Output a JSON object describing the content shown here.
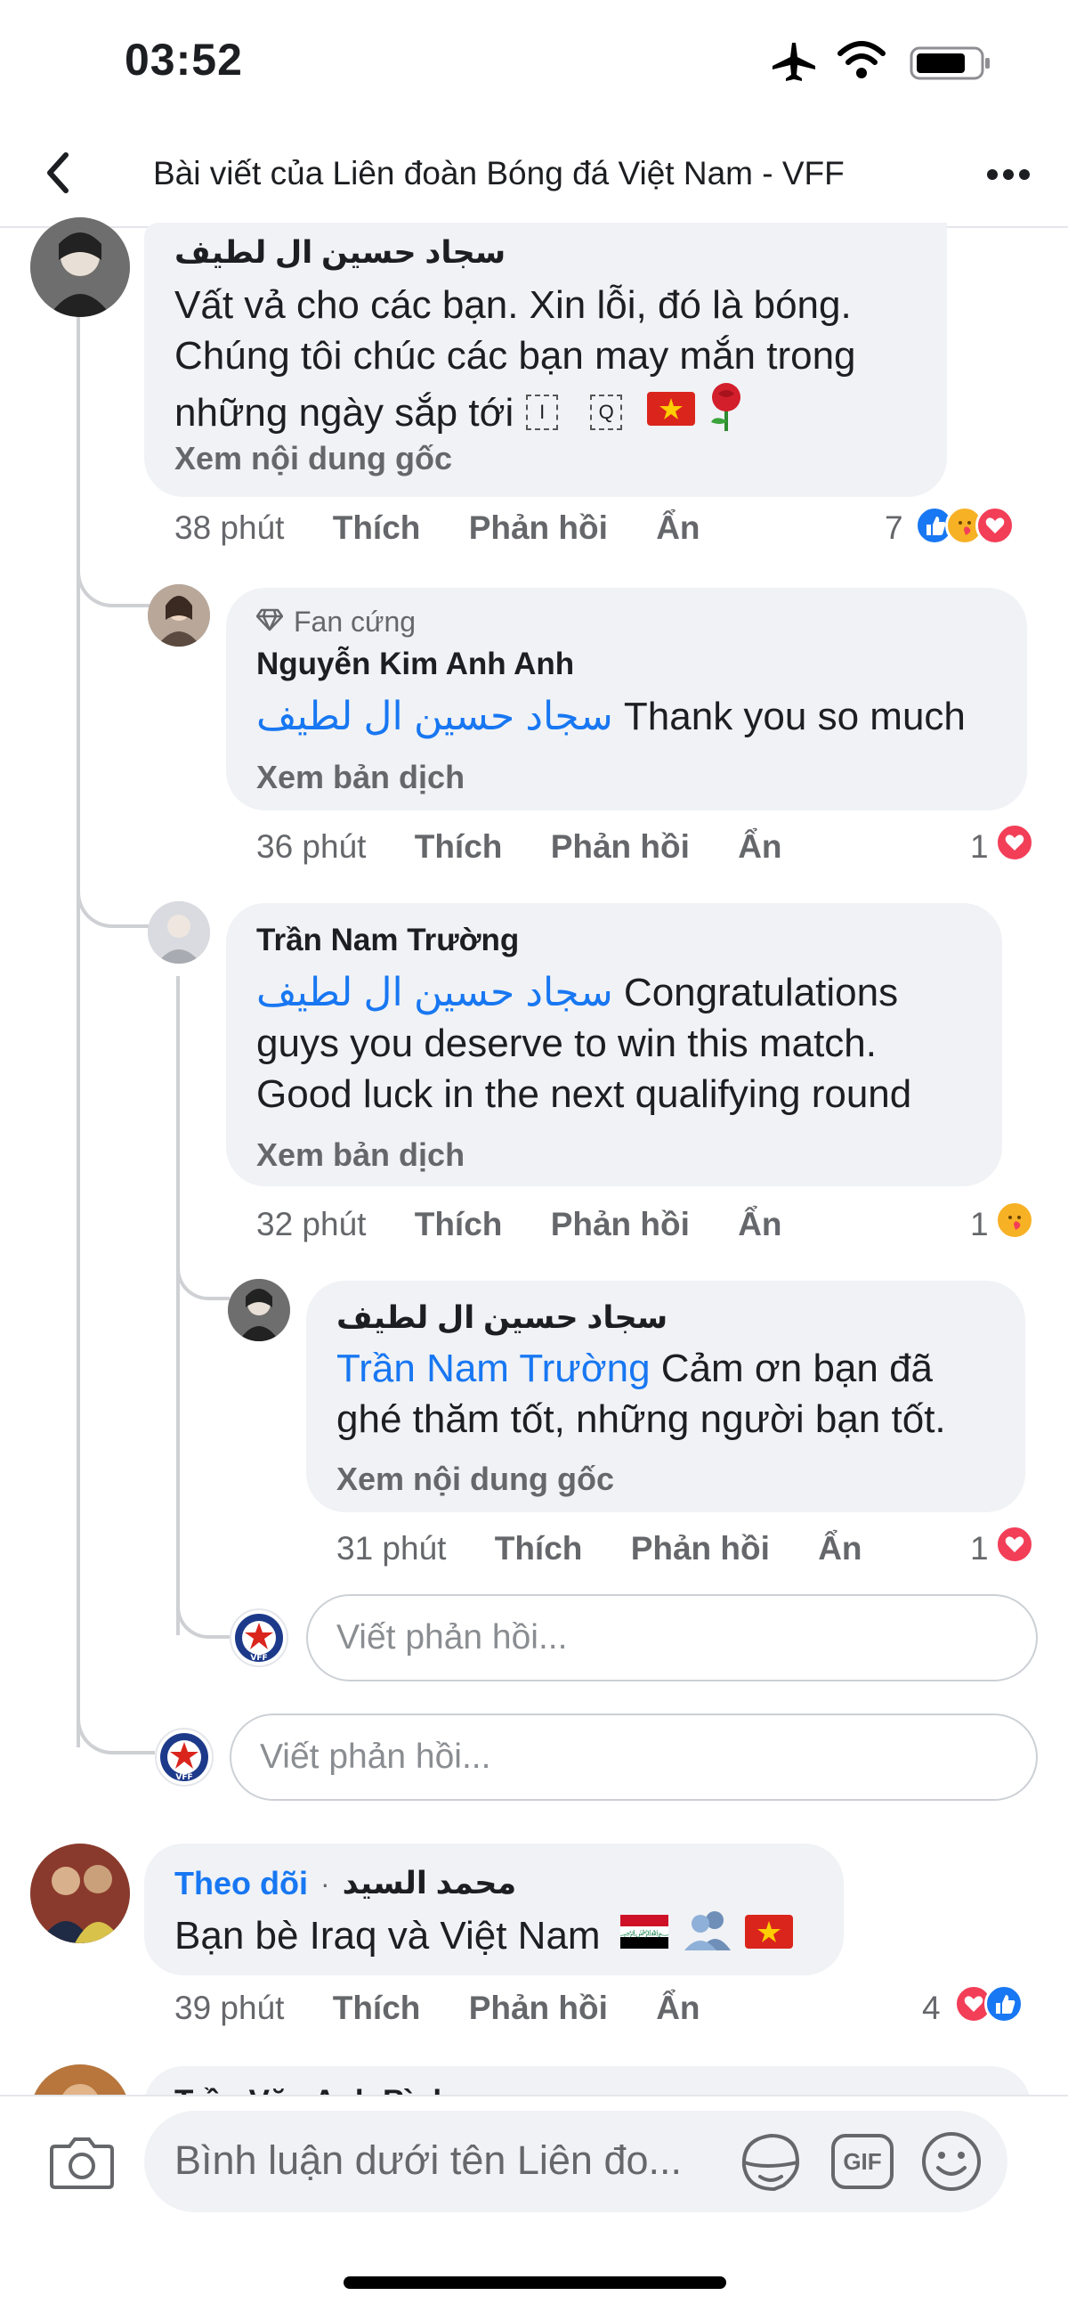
{
  "status_bar": {
    "time": "03:52"
  },
  "header": {
    "title": "Bài viết của Liên đoàn Bóng đá Việt Nam - VFF"
  },
  "comments": [
    {
      "author": "سجاد حسين ال لطيف",
      "lines": [
        "Vất vả cho các bạn. Xin lỗi, đó là bóng.",
        "Chúng tôi chúc các bạn may mắn trong",
        "những ngày sắp tới"
      ],
      "see_original": "Xem nội dung gốc",
      "time": "38 phút",
      "like": "Thích",
      "reply": "Phản hồi",
      "hide": "Ẩn",
      "reaction_count": "7"
    },
    {
      "badge": "Fan cứng",
      "author": "Nguyễn Kim Anh Anh",
      "mention": "سجاد حسين ال لطيف",
      "text": "Thank you so much",
      "see_translation": "Xem bản dịch",
      "time": "36 phút",
      "like": "Thích",
      "reply": "Phản hồi",
      "hide": "Ẩn",
      "reaction_count": "1"
    },
    {
      "author": "Trần Nam Trường",
      "mention": "سجاد حسين ال لطيف",
      "text_first": "Congratulations",
      "lines": [
        "guys you deserve to win this match.",
        "Good luck in the next qualifying round"
      ],
      "see_translation": "Xem bản dịch",
      "time": "32 phút",
      "like": "Thích",
      "reply": "Phản hồi",
      "hide": "Ẩn",
      "reaction_count": "1"
    },
    {
      "author": "سجاد حسين ال لطيف",
      "mention": "Trần Nam Trường",
      "text_first": "Cảm ơn bạn đã",
      "lines": [
        "ghé thăm tốt, những người bạn tốt."
      ],
      "see_original": "Xem nội dung gốc",
      "time": "31 phút",
      "like": "Thích",
      "reply": "Phản hồi",
      "hide": "Ẩn",
      "reaction_count": "1"
    },
    {
      "follow": "Theo dõi",
      "author": "محمد السيد",
      "text": "Bạn bè Iraq và Việt Nam",
      "time": "39 phút",
      "like": "Thích",
      "reply": "Phản hồi",
      "hide": "Ẩn",
      "reaction_count": "4"
    }
  ],
  "reply_placeholder": "Viết phản hồi...",
  "reply_placeholder_outer": "Viết phản hồi...",
  "partial_author": "Trần Văn Anh Bình",
  "bottom_bar": {
    "comment_placeholder": "Bình luận dưới tên Liên đo...",
    "gif_label": "GIF"
  },
  "avatar_label": "VFF",
  "colors": {
    "accent": "#1877f2",
    "bubble": "#f0f2f5",
    "muted": "#65676b",
    "love": "#f33e58",
    "flag_red": "#da251d"
  }
}
